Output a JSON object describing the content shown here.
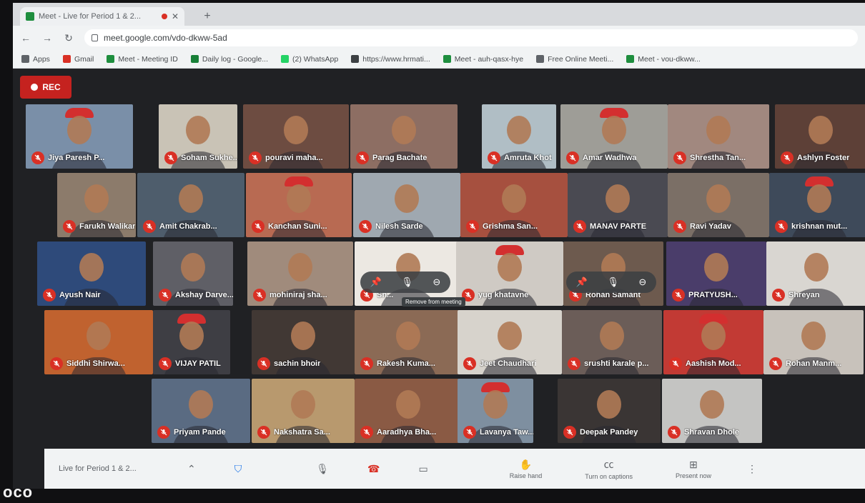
{
  "browser": {
    "tab_title": "Meet - Live for Period 1 & 2...",
    "url": "meet.google.com/vdo-dkww-5ad",
    "bookmarks": [
      {
        "label": "Apps",
        "color": "#5f6368"
      },
      {
        "label": "Gmail",
        "color": "#d93025"
      },
      {
        "label": "Meet - Meeting ID",
        "color": "#1e8e3e"
      },
      {
        "label": "Daily log - Google...",
        "color": "#188038"
      },
      {
        "label": "(2) WhatsApp",
        "color": "#25d366"
      },
      {
        "label": "https://www.hrmati...",
        "color": "#3c4043"
      },
      {
        "label": "Meet - auh-qasx-hye",
        "color": "#1e8e3e"
      },
      {
        "label": "Free Online Meeti...",
        "color": "#5f6368"
      },
      {
        "label": "Meet - vou-dkww...",
        "color": "#1e8e3e"
      }
    ]
  },
  "recording": {
    "label": "REC"
  },
  "participants": [
    {
      "name": "Jiya Paresh P..."
    },
    {
      "name": "Soham Sukhe..."
    },
    {
      "name": "pouravi maha..."
    },
    {
      "name": "Parag Bachate"
    },
    {
      "name": "Amruta Khot"
    },
    {
      "name": "Amar Wadhwa"
    },
    {
      "name": "Shrestha Tan..."
    },
    {
      "name": "Ashlyn Foster"
    },
    {
      "name": "Farukh Walikar"
    },
    {
      "name": "Amit Chakrab..."
    },
    {
      "name": "Kanchan Suni..."
    },
    {
      "name": "Nilesh Sarde"
    },
    {
      "name": "Grishma San..."
    },
    {
      "name": "MANAV PARTE"
    },
    {
      "name": "Ravi Yadav"
    },
    {
      "name": "krishnan mut..."
    },
    {
      "name": "Ayush Nair"
    },
    {
      "name": "Akshay Darve..."
    },
    {
      "name": "mohiniraj sha..."
    },
    {
      "name": "Sh..."
    },
    {
      "name": "yug khatavne"
    },
    {
      "name": "Rohan Samant"
    },
    {
      "name": "PRATYUSH..."
    },
    {
      "name": "Shreyan"
    },
    {
      "name": "Siddhi Shirwa..."
    },
    {
      "name": "VIJAY PATIL"
    },
    {
      "name": "sachin bhoir"
    },
    {
      "name": "Rakesh Kuma..."
    },
    {
      "name": "Jeet Chaudhari"
    },
    {
      "name": "srushti karale p..."
    },
    {
      "name": "Aashish Mod..."
    },
    {
      "name": "Rohan Manm..."
    },
    {
      "name": "Priyam Pande"
    },
    {
      "name": "Nakshatra Sa..."
    },
    {
      "name": "Aaradhya Bha..."
    },
    {
      "name": "Lavanya Taw..."
    },
    {
      "name": "Deepak Pandey"
    },
    {
      "name": "Shravan Dhole"
    }
  ],
  "tooltip": "Remove from meeting",
  "bottom_bar": {
    "meeting_title": "Live for Period 1 & 2...",
    "raise_hand": "Raise hand",
    "captions": "Turn on captions",
    "present": "Present now"
  },
  "watermark": "oco"
}
